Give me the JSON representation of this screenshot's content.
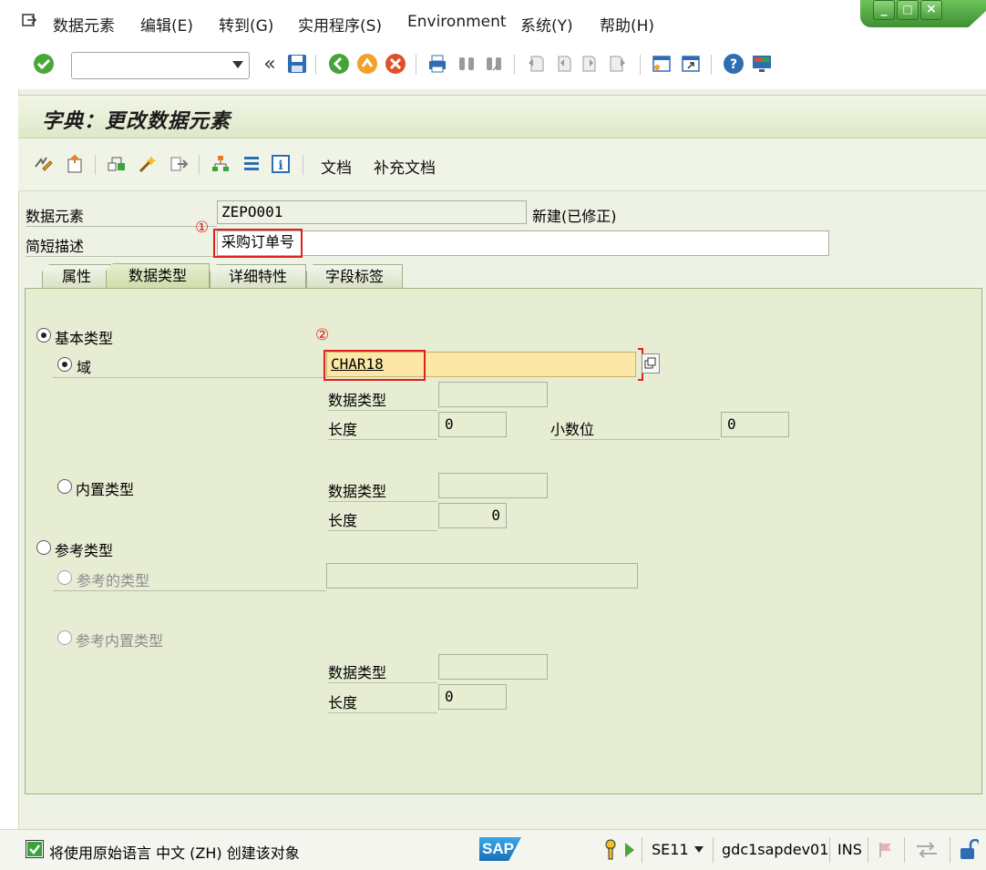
{
  "menu": {
    "items": [
      "数据元素",
      "编辑(E)",
      "转到(G)",
      "实用程序(S)",
      "Environment",
      "系统(Y)",
      "帮助(H)"
    ]
  },
  "window_controls": [
    "_",
    "□",
    "×"
  ],
  "toolbar": {
    "command_field_value": "",
    "icons": [
      "enter-icon",
      "back-icon",
      "save-icon",
      "back-green-icon",
      "exit-icon",
      "cancel-icon",
      "print-icon",
      "find-icon",
      "find-next-icon",
      "first-page-icon",
      "prev-page-icon",
      "next-page-icon",
      "last-page-icon",
      "new-session-icon",
      "shortcut-icon",
      "help-icon",
      "customize-icon"
    ]
  },
  "page": {
    "title": "字典：更改数据元素"
  },
  "app_toolbar": {
    "doc_label": "文档",
    "supp_doc_label": "补充文档"
  },
  "header": {
    "data_element_label": "数据元素",
    "data_element_value": "ZEPO001",
    "status": "新建(已修正)",
    "short_desc_label": "简短描述",
    "short_desc_value": "采购订单号",
    "marker1": "①"
  },
  "tabs": [
    {
      "label": "属性",
      "active": false
    },
    {
      "label": "数据类型",
      "active": true
    },
    {
      "label": "详细特性",
      "active": false
    },
    {
      "label": "字段标签",
      "active": false
    }
  ],
  "datatype": {
    "basic_type_label": "基本类型",
    "domain_label": "域",
    "domain_value": "CHAR18",
    "marker2": "②",
    "datatype_label": "数据类型",
    "datatype_value": "",
    "length_label": "长度",
    "length_value": "0",
    "decimals_label": "小数位",
    "decimals_value": "0",
    "builtin_label": "内置类型",
    "builtin_datatype_label": "数据类型",
    "builtin_datatype_value": "",
    "builtin_length_label": "长度",
    "builtin_length_value": "0",
    "ref_type_label": "参考类型",
    "ref_of_type_label": "参考的类型",
    "ref_of_type_value": "",
    "ref_builtin_label": "参考内置类型",
    "ref_datatype_label": "数据类型",
    "ref_datatype_value": "",
    "ref_length_label": "长度",
    "ref_length_value": "0"
  },
  "statusbar": {
    "message": "将使用原始语言 中文 (ZH) 创建该对象",
    "logo": "SAP",
    "transaction": "SE11",
    "server": "gdc1sapdev01",
    "mode": "INS"
  },
  "colors": {
    "panel_bg": "#eef2e4",
    "tab_body_bg": "#e6edd2",
    "required_field_bg": "#fbe8a6",
    "highlight_red": "#e02020",
    "window_green": "#4aa03c"
  }
}
